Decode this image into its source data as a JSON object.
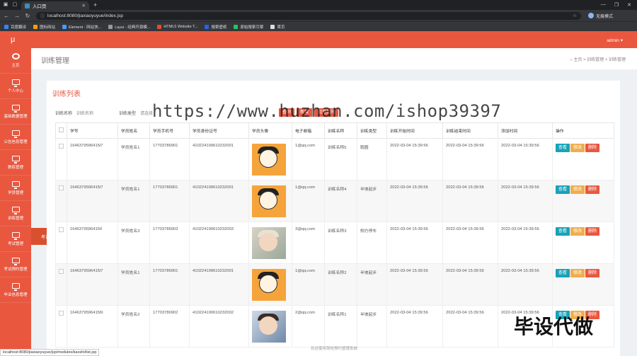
{
  "browser": {
    "tab_title": "入口页",
    "url": "localhost:8080/jiaxiaoyuyue/index.jsp",
    "profile": "无痕模式",
    "status_url": "localhost:8080/jiaxiaoyuyue/jsp/modules/kaoshi/list.jsp",
    "bookmarks": [
      "百度翻译",
      "图标网站",
      "Element - 网站快...",
      "Layui - 经典开源模...",
      "HTML5 Website T...",
      "搜索壁纸",
      "原始搜索引擎",
      "首页"
    ]
  },
  "header": {
    "logo": "μ",
    "user": "admin ▾"
  },
  "sidebar": [
    "主页",
    "个人中心",
    "基础数据管理",
    "公告信息管理",
    "教练管理",
    "学员管理",
    "训练管理",
    "考试管理",
    "考试预约管理",
    "毕业信息管理"
  ],
  "flyout": "考试管理",
  "page": {
    "title": "训练管理",
    "breadcrumb": "⌂ 主页  >  训练管理  >  训练管理",
    "list_title": "训练列表"
  },
  "search": {
    "label1": "训练名称",
    "placeholder1": "训练名称",
    "label2": "训练类型",
    "placeholder2": "请选择",
    "btn_search": "查询",
    "btn_add": "新增",
    "btn_delete": "批量删除"
  },
  "watermark": "https://www.huzhan.com/ishop39397",
  "corner_mark": "毕设代做",
  "footer": "欢迎使用驾校预约管理系统",
  "table": {
    "columns": [
      "学号",
      "学员姓名",
      "学员手机号",
      "学员身份证号",
      "学员头像",
      "电子邮箱",
      "训练名称",
      "训练类型",
      "训练开始时间",
      "训练结束时间",
      "添加时间",
      "操作"
    ],
    "rows": [
      {
        "id": "1646379596415l7",
        "name": "学员姓名1",
        "phone": "17703786901",
        "card": "410224199610232001",
        "email": "1@qq.com",
        "train": "训练名称5",
        "type": "跑圈",
        "start": "2022-03-04 15:39:56",
        "end": "2022-03-04 15:39:56",
        "add": "2022-03-04 15:39:56"
      },
      {
        "id": "1646379596415l7",
        "name": "学员姓名1",
        "phone": "17703786901",
        "card": "410224199610232001",
        "email": "1@qq.com",
        "train": "训练名称4",
        "type": "半坡起步",
        "start": "2022-03-04 15:39:56",
        "end": "2022-03-04 15:39:56",
        "add": "2022-03-04 15:39:56"
      },
      {
        "id": "1646379596415б",
        "name": "学员姓名3",
        "phone": "17703786903",
        "card": "410224199610232003",
        "email": "3@qq.com",
        "train": "训练名称3",
        "type": "侧方停车",
        "start": "2022-03-04 15:39:56",
        "end": "2022-03-04 15:39:56",
        "add": "2022-03-04 15:39:56"
      },
      {
        "id": "1646379596415l7",
        "name": "学员姓名1",
        "phone": "17703786901",
        "card": "410224199610232001",
        "email": "1@qq.com",
        "train": "训练名称2",
        "type": "半坡起步",
        "start": "2022-03-04 15:39:56",
        "end": "2022-03-04 15:39:56",
        "add": "2022-03-04 15:39:56"
      },
      {
        "id": "1646379596415l9",
        "name": "学员姓名2",
        "phone": "17703786902",
        "card": "410224199610232002",
        "email": "2@qq.com",
        "train": "训练名称1",
        "type": "半坡起步",
        "start": "2022-03-04 15:39:56",
        "end": "2022-03-04 15:39:56",
        "add": "2022-03-04 15:39:56"
      }
    ],
    "actions": {
      "view": "查看",
      "edit": "修改",
      "del": "删除"
    }
  }
}
